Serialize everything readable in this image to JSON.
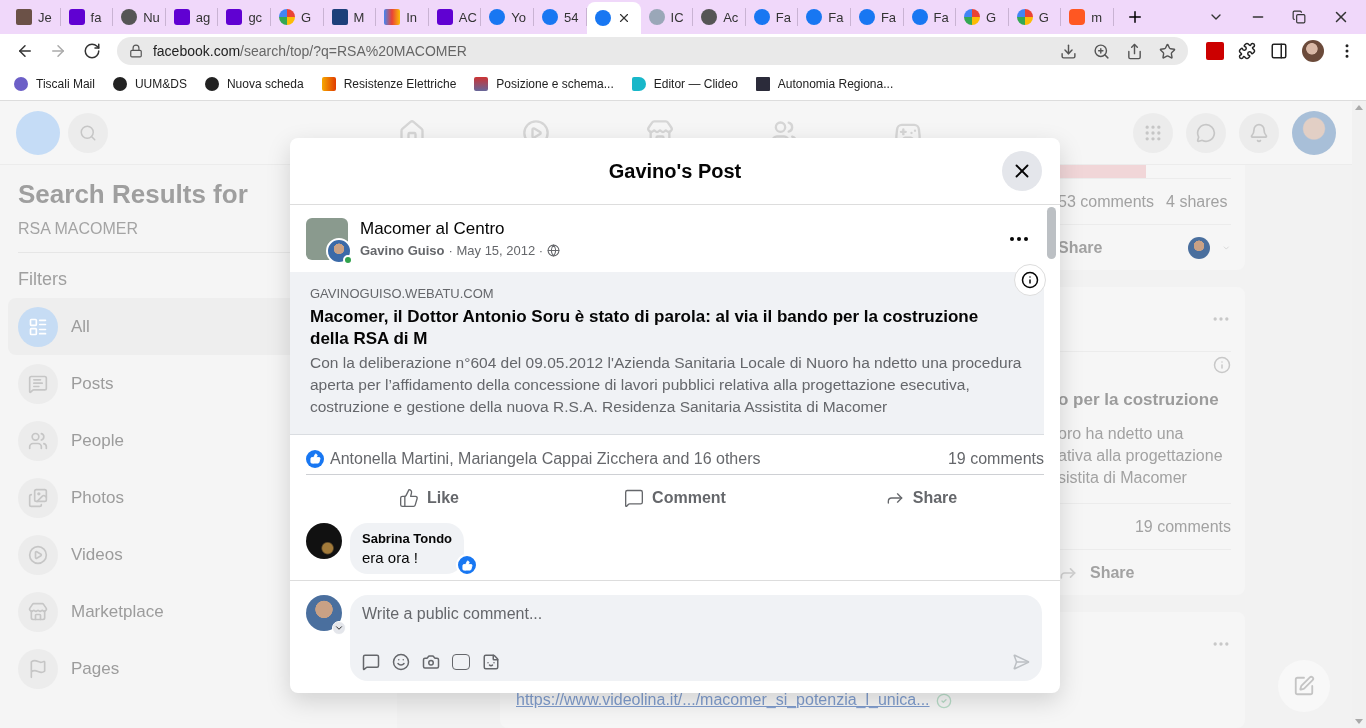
{
  "browser": {
    "tabs": [
      {
        "title": "Je",
        "kind": "photo",
        "selected": false
      },
      {
        "title": "fa",
        "kind": "yahoo",
        "selected": false
      },
      {
        "title": "Nu",
        "kind": "globe",
        "selected": false
      },
      {
        "title": "ag",
        "kind": "yahoo",
        "selected": false
      },
      {
        "title": "gc",
        "kind": "yahoo",
        "selected": false
      },
      {
        "title": "G",
        "kind": "google",
        "selected": false
      },
      {
        "title": "M",
        "kind": "news",
        "selected": false
      },
      {
        "title": "In",
        "kind": "gmail",
        "selected": false
      },
      {
        "title": "AC",
        "kind": "yahoo",
        "selected": false
      },
      {
        "title": "Yo",
        "kind": "facebook",
        "selected": false
      },
      {
        "title": "54",
        "kind": "facebook",
        "selected": false
      },
      {
        "kind": "facebook",
        "selected": true
      },
      {
        "title": "IC",
        "kind": "tracker",
        "selected": false
      },
      {
        "title": "Ac",
        "kind": "globe",
        "selected": false
      },
      {
        "title": "Fa",
        "kind": "facebook",
        "selected": false
      },
      {
        "title": "Fa",
        "kind": "facebook",
        "selected": false
      },
      {
        "title": "Fa",
        "kind": "facebook",
        "selected": false
      },
      {
        "title": "Fa",
        "kind": "facebook",
        "selected": false
      },
      {
        "title": "G",
        "kind": "google",
        "selected": false
      },
      {
        "title": "G",
        "kind": "google",
        "selected": false
      },
      {
        "title": "m",
        "kind": "blogger",
        "selected": false
      }
    ],
    "nav": [
      {
        "kind": "back",
        "disabled": false
      },
      {
        "kind": "forward",
        "disabled": true
      },
      {
        "kind": "reload",
        "disabled": false
      }
    ],
    "url": {
      "host": "facebook.com",
      "path": "/search/top/?q=RSA%20MACOMER"
    },
    "bookmarks": [
      {
        "label": "Tiscali Mail",
        "kind": "stripes"
      },
      {
        "label": "UUM&DS",
        "kind": "globe"
      },
      {
        "label": "Nuova scheda",
        "kind": "globe"
      },
      {
        "label": "Resistenze Elettriche",
        "kind": "flame"
      },
      {
        "label": "Posizione e schema...",
        "kind": "sa"
      },
      {
        "label": "Editor — Clideo",
        "kind": "play"
      },
      {
        "label": "Autonomia Regiona...",
        "kind": "dark"
      }
    ]
  },
  "page": {
    "sidebar": {
      "heading": "Search Results for",
      "query": "RSA MACOMER",
      "filters_label": "Filters",
      "filters": [
        {
          "label": "All",
          "kind": "all",
          "selected": true
        },
        {
          "label": "Posts",
          "kind": "posts",
          "selected": false
        },
        {
          "label": "People",
          "kind": "people",
          "selected": false
        },
        {
          "label": "Photos",
          "kind": "photos",
          "selected": false
        },
        {
          "label": "Videos",
          "kind": "videos",
          "selected": false
        },
        {
          "label": "Marketplace",
          "kind": "marketplace",
          "selected": false
        },
        {
          "label": "Pages",
          "kind": "pages",
          "selected": false
        }
      ]
    },
    "feed": [
      {
        "kind": "stats",
        "comments": "53 comments",
        "shares": "4 shares",
        "action": "Share"
      },
      {
        "kind": "link",
        "title": "o per la costruzione",
        "lines": [
          "oro ha ndetto una",
          "ativa alla progettazione",
          "sistita di Macomer"
        ],
        "comments": "19 comments",
        "action": "Share"
      },
      {
        "kind": "url",
        "url": "https://www.videolina.it/.../macomer_si_potenzia_l_unica..."
      }
    ]
  },
  "modal": {
    "title": "Gavino's Post",
    "post": {
      "page": "Macomer al Centro",
      "author": "Gavino Guiso",
      "meta": "· May 15, 2012 ·",
      "online": true,
      "link": {
        "domain": "GAVINOGUISO.WEBATU.COM",
        "title": "Macomer, il Dottor Antonio Soru è stato di parola: al via il bando per la costruzione della RSA di M",
        "description": "Con la deliberazione n°604 del 09.05.2012 l'Azienda Sanitaria Locale di Nuoro ha ndetto una procedura aperta per l’affidamento della concessione di lavori pubblici relativa alla progettazione esecutiva, costruzione e gestione della nuova R.S.A. Residenza Sanitaria Assistita di Macomer"
      },
      "reactions": "Antonella Martini, Mariangela Cappai Zicchera and 16 others",
      "comments_count": "19 comments",
      "actions": [
        {
          "label": "Like",
          "kind": "like"
        },
        {
          "label": "Comment",
          "kind": "comment"
        },
        {
          "label": "Share",
          "kind": "share"
        }
      ],
      "comments": [
        {
          "author": "Sabrina Tondo",
          "text": "era ora !",
          "liked": true
        }
      ]
    },
    "composer": {
      "placeholder": "Write a public comment..."
    }
  }
}
